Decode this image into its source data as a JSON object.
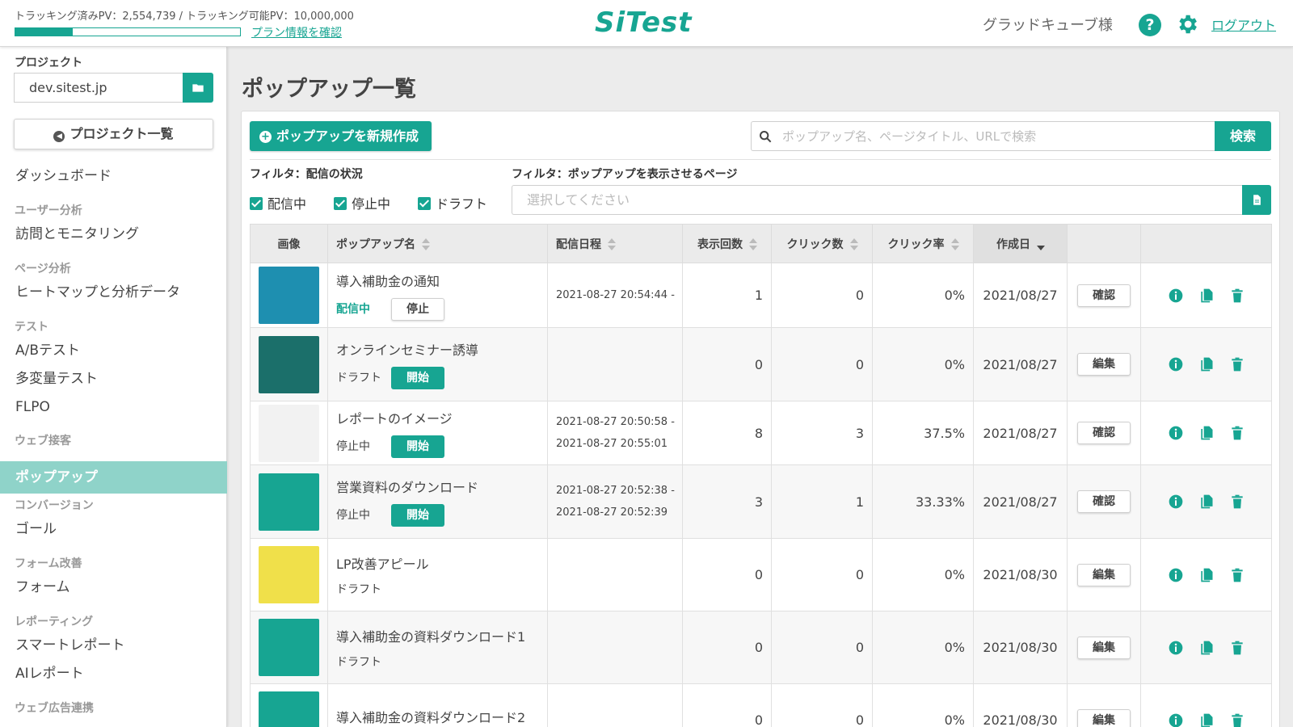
{
  "header": {
    "tracking_text": "トラッキング済みPV：2,554,739 / トラッキング可能PV：10,000,000",
    "tracking_progress": 0.255,
    "plan_link": "プラン情報を確認",
    "logo": "SiTest",
    "customer": "グラッドキューブ様",
    "help_icon": "?",
    "logout": "ログアウト"
  },
  "sidebar": {
    "project_label": "プロジェクト",
    "project_value": "dev.sitest.jp",
    "project_list_button": "プロジェクト一覧",
    "dashboard": "ダッシュボード",
    "sections": {
      "user_analysis": "ユーザー分析",
      "page_analysis": "ページ分析",
      "test": "テスト",
      "web_service": "ウェブ接客",
      "conversion": "コンバージョン",
      "form_improvement": "フォーム改善",
      "reporting": "レポーティング",
      "web_ads": "ウェブ広告連携"
    },
    "items": {
      "visits": "訪問とモニタリング",
      "heatmap": "ヒートマップと分析データ",
      "ab_test": "A/Bテスト",
      "multivariate": "多変量テスト",
      "flpo": "FLPO",
      "popup": "ポップアップ",
      "goal": "ゴール",
      "form": "フォーム",
      "smart_report": "スマートレポート",
      "ai_report": "AIレポート"
    }
  },
  "main": {
    "title": "ポップアップ一覧",
    "new_button": "ポップアップを新規作成",
    "search_placeholder": "ポップアップ名、ページタイトル、URLで検索",
    "search_button": "検索",
    "filter_status_label": "フィルタ：配信の状況",
    "filter_page_label": "フィルタ：ポップアップを表示させるページ",
    "checkboxes": [
      "配信中",
      "停止中",
      "ドラフト"
    ],
    "page_select_placeholder": "選択してください",
    "columns": {
      "image": "画像",
      "name": "ポップアップ名",
      "schedule": "配信日程",
      "impressions": "表示回数",
      "clicks": "クリック数",
      "ctr": "クリック率",
      "created": "作成日"
    },
    "rows": [
      {
        "name": "導入補助金の通知",
        "status": "配信中",
        "status_button": "停止",
        "schedule_start": "2021-08-27 20:54:44 -",
        "schedule_end": "",
        "impressions": "1",
        "clicks": "0",
        "ctr": "0%",
        "created": "2021/08/27",
        "action": "確認",
        "thumb_color": "#1e8fb0"
      },
      {
        "name": "オンラインセミナー誘導",
        "status": "ドラフト",
        "status_button": "開始",
        "schedule_start": "",
        "schedule_end": "",
        "impressions": "0",
        "clicks": "0",
        "ctr": "0%",
        "created": "2021/08/27",
        "action": "編集",
        "thumb_color": "#1b6f6a"
      },
      {
        "name": "レポートのイメージ",
        "status": "停止中",
        "status_button": "開始",
        "schedule_start": "2021-08-27 20:50:58 -",
        "schedule_end": "2021-08-27 20:55:01",
        "impressions": "8",
        "clicks": "3",
        "ctr": "37.5%",
        "created": "2021/08/27",
        "action": "確認",
        "thumb_color": "#f2f2f2"
      },
      {
        "name": "営業資料のダウンロード",
        "status": "停止中",
        "status_button": "開始",
        "schedule_start": "2021-08-27 20:52:38 -",
        "schedule_end": "2021-08-27 20:52:39",
        "impressions": "3",
        "clicks": "1",
        "ctr": "33.33%",
        "created": "2021/08/27",
        "action": "確認",
        "thumb_color": "#17a592"
      },
      {
        "name": "LP改善アピール",
        "status": "ドラフト",
        "status_button": "",
        "schedule_start": "",
        "schedule_end": "",
        "impressions": "0",
        "clicks": "0",
        "ctr": "0%",
        "created": "2021/08/30",
        "action": "編集",
        "thumb_color": "#f0e04a"
      },
      {
        "name": "導入補助金の資料ダウンロード1",
        "status": "ドラフト",
        "status_button": "",
        "schedule_start": "",
        "schedule_end": "",
        "impressions": "0",
        "clicks": "0",
        "ctr": "0%",
        "created": "2021/08/30",
        "action": "編集",
        "thumb_color": "#17a592"
      },
      {
        "name": "導入補助金の資料ダウンロード2",
        "status": "",
        "status_button": "",
        "schedule_start": "",
        "schedule_end": "",
        "impressions": "0",
        "clicks": "0",
        "ctr": "0%",
        "created": "2021/08/30",
        "action": "編集",
        "thumb_color": "#17a592"
      }
    ]
  },
  "colors": {
    "accent": "#17a592",
    "active_nav": "#8fd3c9"
  }
}
